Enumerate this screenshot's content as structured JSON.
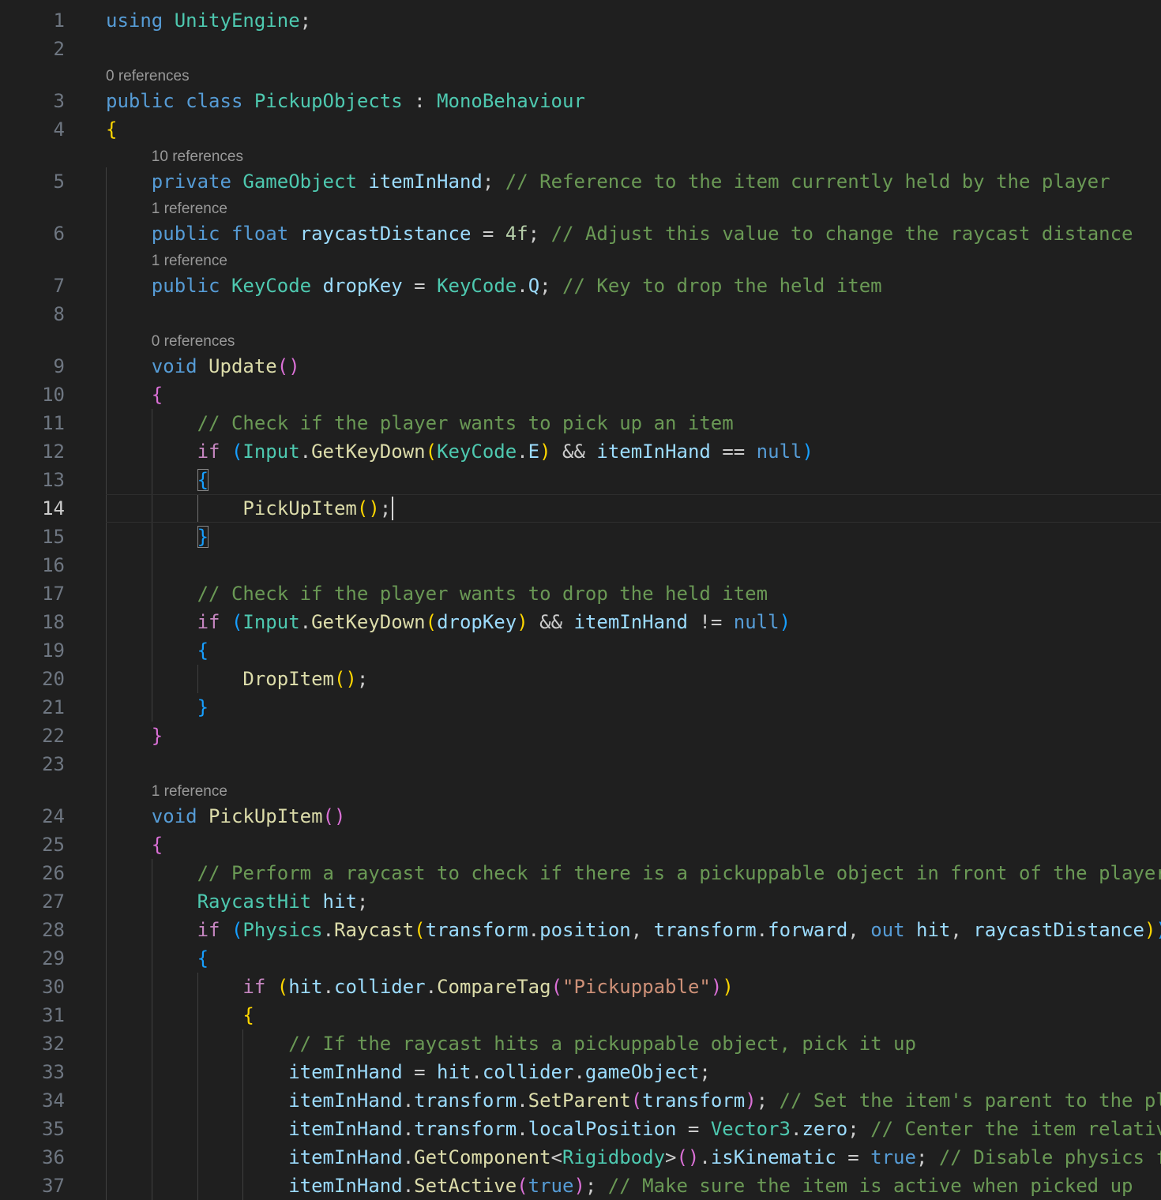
{
  "editor": {
    "active_line": 14,
    "language": "C#",
    "lines": [
      {
        "n": "1",
        "lens": "",
        "tokens": [
          [
            "using",
            "kw"
          ],
          [
            " ",
            "pl"
          ],
          [
            "UnityEngine",
            "ty"
          ],
          [
            ";",
            "pl"
          ]
        ]
      },
      {
        "n": "2",
        "lens": "",
        "tokens": []
      },
      {
        "n": "3",
        "lens": "0 references",
        "tokens": [
          [
            "public",
            "kw"
          ],
          [
            " ",
            "pl"
          ],
          [
            "class",
            "kw"
          ],
          [
            " ",
            "pl"
          ],
          [
            "PickupObjects",
            "ty"
          ],
          [
            " : ",
            "pl"
          ],
          [
            "MonoBehaviour",
            "ty"
          ]
        ]
      },
      {
        "n": "4",
        "lens": "",
        "tokens": [
          [
            "{",
            "b1"
          ]
        ]
      },
      {
        "n": "5",
        "lens": "10 references",
        "tokens": [
          [
            "    ",
            "pl"
          ],
          [
            "private",
            "kw"
          ],
          [
            " ",
            "pl"
          ],
          [
            "GameObject",
            "ty"
          ],
          [
            " ",
            "pl"
          ],
          [
            "itemInHand",
            "var"
          ],
          [
            "; ",
            "pl"
          ],
          [
            "// Reference to the item currently held by the player",
            "cm"
          ]
        ]
      },
      {
        "n": "6",
        "lens": "1 reference",
        "tokens": [
          [
            "    ",
            "pl"
          ],
          [
            "public",
            "kw"
          ],
          [
            " ",
            "pl"
          ],
          [
            "float",
            "kw"
          ],
          [
            " ",
            "pl"
          ],
          [
            "raycastDistance",
            "var"
          ],
          [
            " = ",
            "pl"
          ],
          [
            "4f",
            "num"
          ],
          [
            "; ",
            "pl"
          ],
          [
            "// Adjust this value to change the raycast distance",
            "cm"
          ]
        ]
      },
      {
        "n": "7",
        "lens": "1 reference",
        "tokens": [
          [
            "    ",
            "pl"
          ],
          [
            "public",
            "kw"
          ],
          [
            " ",
            "pl"
          ],
          [
            "KeyCode",
            "ty"
          ],
          [
            " ",
            "pl"
          ],
          [
            "dropKey",
            "var"
          ],
          [
            " = ",
            "pl"
          ],
          [
            "KeyCode",
            "ty"
          ],
          [
            ".",
            "pl"
          ],
          [
            "Q",
            "var"
          ],
          [
            "; ",
            "pl"
          ],
          [
            "// Key to drop the held item",
            "cm"
          ]
        ]
      },
      {
        "n": "8",
        "lens": "",
        "tokens": []
      },
      {
        "n": "9",
        "lens": "0 references",
        "tokens": [
          [
            "    ",
            "pl"
          ],
          [
            "void",
            "kw"
          ],
          [
            " ",
            "pl"
          ],
          [
            "Update",
            "fn"
          ],
          [
            "()",
            "b2"
          ]
        ]
      },
      {
        "n": "10",
        "lens": "",
        "tokens": [
          [
            "    ",
            "pl"
          ],
          [
            "{",
            "b2"
          ]
        ]
      },
      {
        "n": "11",
        "lens": "",
        "tokens": [
          [
            "        ",
            "pl"
          ],
          [
            "// Check if the player wants to pick up an item",
            "cm"
          ]
        ]
      },
      {
        "n": "12",
        "lens": "",
        "tokens": [
          [
            "        ",
            "pl"
          ],
          [
            "if",
            "ctl"
          ],
          [
            " ",
            "pl"
          ],
          [
            "(",
            "b3"
          ],
          [
            "Input",
            "ty"
          ],
          [
            ".",
            "pl"
          ],
          [
            "GetKeyDown",
            "fn"
          ],
          [
            "(",
            "b1"
          ],
          [
            "KeyCode",
            "ty"
          ],
          [
            ".",
            "pl"
          ],
          [
            "E",
            "var"
          ],
          [
            ")",
            "b1"
          ],
          [
            " && ",
            "pl"
          ],
          [
            "itemInHand",
            "var"
          ],
          [
            " == ",
            "pl"
          ],
          [
            "null",
            "kw"
          ],
          [
            ")",
            "b3"
          ]
        ]
      },
      {
        "n": "13",
        "lens": "",
        "tokens": [
          [
            "        ",
            "pl"
          ],
          [
            "{",
            "b3 brmatch"
          ]
        ]
      },
      {
        "n": "14",
        "lens": "",
        "tokens": [
          [
            "            ",
            "pl"
          ],
          [
            "PickUpItem",
            "fn"
          ],
          [
            "()",
            "b1"
          ],
          [
            ";",
            "pl"
          ]
        ]
      },
      {
        "n": "15",
        "lens": "",
        "tokens": [
          [
            "        ",
            "pl"
          ],
          [
            "}",
            "b3 brmatch"
          ]
        ]
      },
      {
        "n": "16",
        "lens": "",
        "tokens": []
      },
      {
        "n": "17",
        "lens": "",
        "tokens": [
          [
            "        ",
            "pl"
          ],
          [
            "// Check if the player wants to drop the held item",
            "cm"
          ]
        ]
      },
      {
        "n": "18",
        "lens": "",
        "tokens": [
          [
            "        ",
            "pl"
          ],
          [
            "if",
            "ctl"
          ],
          [
            " ",
            "pl"
          ],
          [
            "(",
            "b3"
          ],
          [
            "Input",
            "ty"
          ],
          [
            ".",
            "pl"
          ],
          [
            "GetKeyDown",
            "fn"
          ],
          [
            "(",
            "b1"
          ],
          [
            "dropKey",
            "var"
          ],
          [
            ")",
            "b1"
          ],
          [
            " && ",
            "pl"
          ],
          [
            "itemInHand",
            "var"
          ],
          [
            " != ",
            "pl"
          ],
          [
            "null",
            "kw"
          ],
          [
            ")",
            "b3"
          ]
        ]
      },
      {
        "n": "19",
        "lens": "",
        "tokens": [
          [
            "        ",
            "pl"
          ],
          [
            "{",
            "b3"
          ]
        ]
      },
      {
        "n": "20",
        "lens": "",
        "tokens": [
          [
            "            ",
            "pl"
          ],
          [
            "DropItem",
            "fn"
          ],
          [
            "()",
            "b1"
          ],
          [
            ";",
            "pl"
          ]
        ]
      },
      {
        "n": "21",
        "lens": "",
        "tokens": [
          [
            "        ",
            "pl"
          ],
          [
            "}",
            "b3"
          ]
        ]
      },
      {
        "n": "22",
        "lens": "",
        "tokens": [
          [
            "    ",
            "pl"
          ],
          [
            "}",
            "b2"
          ]
        ]
      },
      {
        "n": "23",
        "lens": "",
        "tokens": []
      },
      {
        "n": "24",
        "lens": "1 reference",
        "tokens": [
          [
            "    ",
            "pl"
          ],
          [
            "void",
            "kw"
          ],
          [
            " ",
            "pl"
          ],
          [
            "PickUpItem",
            "fn"
          ],
          [
            "()",
            "b2"
          ]
        ]
      },
      {
        "n": "25",
        "lens": "",
        "tokens": [
          [
            "    ",
            "pl"
          ],
          [
            "{",
            "b2"
          ]
        ]
      },
      {
        "n": "26",
        "lens": "",
        "tokens": [
          [
            "        ",
            "pl"
          ],
          [
            "// Perform a raycast to check if there is a pickuppable object in front of the player",
            "cm"
          ]
        ]
      },
      {
        "n": "27",
        "lens": "",
        "tokens": [
          [
            "        ",
            "pl"
          ],
          [
            "RaycastHit",
            "ty"
          ],
          [
            " ",
            "pl"
          ],
          [
            "hit",
            "var"
          ],
          [
            ";",
            "pl"
          ]
        ]
      },
      {
        "n": "28",
        "lens": "",
        "tokens": [
          [
            "        ",
            "pl"
          ],
          [
            "if",
            "ctl"
          ],
          [
            " ",
            "pl"
          ],
          [
            "(",
            "b3"
          ],
          [
            "Physics",
            "ty"
          ],
          [
            ".",
            "pl"
          ],
          [
            "Raycast",
            "fn"
          ],
          [
            "(",
            "b1"
          ],
          [
            "transform",
            "var"
          ],
          [
            ".",
            "pl"
          ],
          [
            "position",
            "var"
          ],
          [
            ", ",
            "pl"
          ],
          [
            "transform",
            "var"
          ],
          [
            ".",
            "pl"
          ],
          [
            "forward",
            "var"
          ],
          [
            ", ",
            "pl"
          ],
          [
            "out",
            "kw"
          ],
          [
            " ",
            "pl"
          ],
          [
            "hit",
            "var"
          ],
          [
            ", ",
            "pl"
          ],
          [
            "raycastDistance",
            "var"
          ],
          [
            ")",
            "b1"
          ],
          [
            ")",
            "b3"
          ]
        ]
      },
      {
        "n": "29",
        "lens": "",
        "tokens": [
          [
            "        ",
            "pl"
          ],
          [
            "{",
            "b3"
          ]
        ]
      },
      {
        "n": "30",
        "lens": "",
        "tokens": [
          [
            "            ",
            "pl"
          ],
          [
            "if",
            "ctl"
          ],
          [
            " ",
            "pl"
          ],
          [
            "(",
            "b1"
          ],
          [
            "hit",
            "var"
          ],
          [
            ".",
            "pl"
          ],
          [
            "collider",
            "var"
          ],
          [
            ".",
            "pl"
          ],
          [
            "CompareTag",
            "fn"
          ],
          [
            "(",
            "b2"
          ],
          [
            "\"Pickuppable\"",
            "str"
          ],
          [
            ")",
            "b2"
          ],
          [
            ")",
            "b1"
          ]
        ]
      },
      {
        "n": "31",
        "lens": "",
        "tokens": [
          [
            "            ",
            "pl"
          ],
          [
            "{",
            "b1"
          ]
        ]
      },
      {
        "n": "32",
        "lens": "",
        "tokens": [
          [
            "                ",
            "pl"
          ],
          [
            "// If the raycast hits a pickuppable object, pick it up",
            "cm"
          ]
        ]
      },
      {
        "n": "33",
        "lens": "",
        "tokens": [
          [
            "                ",
            "pl"
          ],
          [
            "itemInHand",
            "var"
          ],
          [
            " = ",
            "pl"
          ],
          [
            "hit",
            "var"
          ],
          [
            ".",
            "pl"
          ],
          [
            "collider",
            "var"
          ],
          [
            ".",
            "pl"
          ],
          [
            "gameObject",
            "var"
          ],
          [
            ";",
            "pl"
          ]
        ]
      },
      {
        "n": "34",
        "lens": "",
        "tokens": [
          [
            "                ",
            "pl"
          ],
          [
            "itemInHand",
            "var"
          ],
          [
            ".",
            "pl"
          ],
          [
            "transform",
            "var"
          ],
          [
            ".",
            "pl"
          ],
          [
            "SetParent",
            "fn"
          ],
          [
            "(",
            "b2"
          ],
          [
            "transform",
            "var"
          ],
          [
            ")",
            "b2"
          ],
          [
            "; ",
            "pl"
          ],
          [
            "// Set the item's parent to the pl",
            "cm"
          ]
        ]
      },
      {
        "n": "35",
        "lens": "",
        "tokens": [
          [
            "                ",
            "pl"
          ],
          [
            "itemInHand",
            "var"
          ],
          [
            ".",
            "pl"
          ],
          [
            "transform",
            "var"
          ],
          [
            ".",
            "pl"
          ],
          [
            "localPosition",
            "var"
          ],
          [
            " = ",
            "pl"
          ],
          [
            "Vector3",
            "ty"
          ],
          [
            ".",
            "pl"
          ],
          [
            "zero",
            "var"
          ],
          [
            "; ",
            "pl"
          ],
          [
            "// Center the item relativ",
            "cm"
          ]
        ]
      },
      {
        "n": "36",
        "lens": "",
        "tokens": [
          [
            "                ",
            "pl"
          ],
          [
            "itemInHand",
            "var"
          ],
          [
            ".",
            "pl"
          ],
          [
            "GetComponent",
            "fn"
          ],
          [
            "<",
            "pl"
          ],
          [
            "Rigidbody",
            "ty"
          ],
          [
            ">",
            "pl"
          ],
          [
            "()",
            "b2"
          ],
          [
            ".",
            "pl"
          ],
          [
            "isKinematic",
            "var"
          ],
          [
            " = ",
            "pl"
          ],
          [
            "true",
            "kw"
          ],
          [
            "; ",
            "pl"
          ],
          [
            "// Disable physics f",
            "cm"
          ]
        ]
      },
      {
        "n": "37",
        "lens": "",
        "tokens": [
          [
            "                ",
            "pl"
          ],
          [
            "itemInHand",
            "var"
          ],
          [
            ".",
            "pl"
          ],
          [
            "SetActive",
            "fn"
          ],
          [
            "(",
            "b2"
          ],
          [
            "true",
            "kw"
          ],
          [
            ")",
            "b2"
          ],
          [
            "; ",
            "pl"
          ],
          [
            "// Make sure the item is active when picked up",
            "cm"
          ]
        ]
      }
    ]
  }
}
